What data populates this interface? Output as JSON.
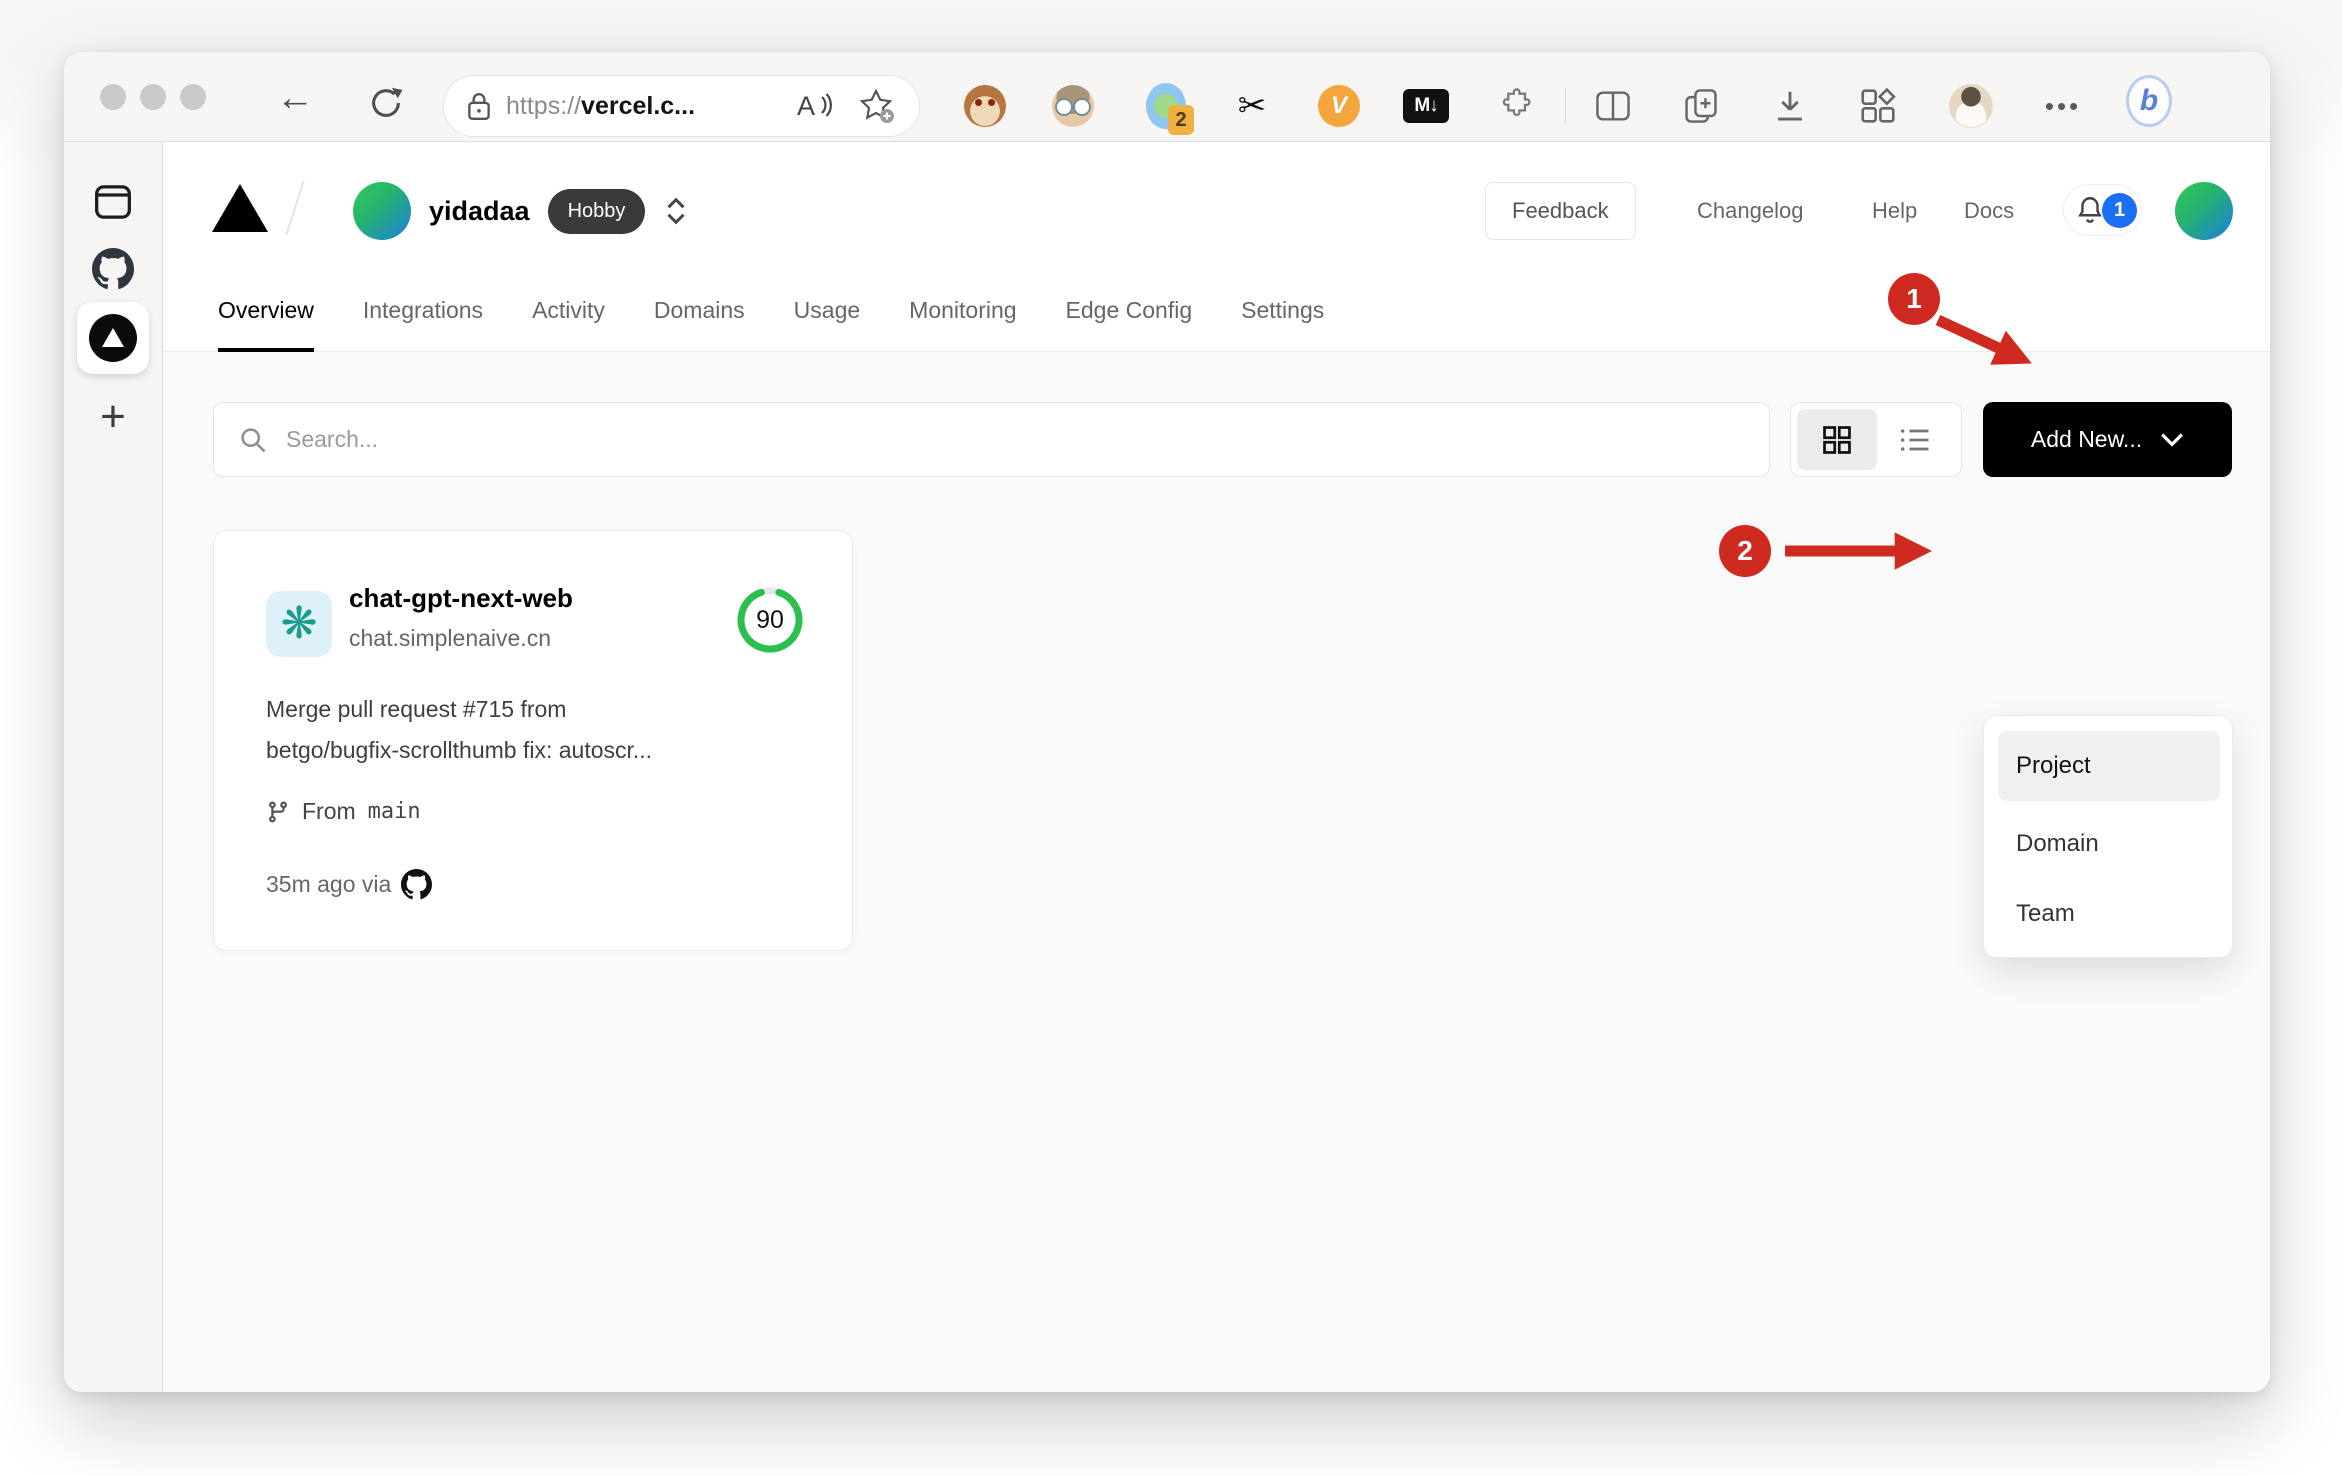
{
  "browser": {
    "url_scheme": "https://",
    "url_host": "vercel.c...",
    "extension_badge": "2",
    "v_extension_label": "V",
    "markdown_extension_label": "M↓",
    "menu_dots": "•••",
    "bing_label": "b"
  },
  "vercel": {
    "header": {
      "team_name": "yidadaa",
      "plan_badge": "Hobby",
      "feedback": "Feedback",
      "links": {
        "changelog": "Changelog",
        "help": "Help",
        "docs": "Docs"
      },
      "notification_count": "1"
    },
    "tabs": [
      {
        "label": "Overview",
        "active": true
      },
      {
        "label": "Integrations"
      },
      {
        "label": "Activity"
      },
      {
        "label": "Domains"
      },
      {
        "label": "Usage"
      },
      {
        "label": "Monitoring"
      },
      {
        "label": "Edge Config"
      },
      {
        "label": "Settings"
      }
    ],
    "toolbar_row": {
      "search_placeholder": "Search...",
      "add_new_label": "Add New..."
    },
    "dropdown": {
      "items": [
        {
          "label": "Project",
          "highlighted": true
        },
        {
          "label": "Domain"
        },
        {
          "label": "Team"
        }
      ]
    },
    "card": {
      "name": "chat-gpt-next-web",
      "domain": "chat.simplenaive.cn",
      "score": "90",
      "commit_line1": "Merge pull request #715 from",
      "commit_line2": "betgo/bugfix-scrollthumb fix: autoscr...",
      "branch_prefix": "From",
      "branch_name": "main",
      "deployed": "35m ago via"
    },
    "annotations": {
      "step1": "1",
      "step2": "2"
    }
  },
  "colors": {
    "annotation_red": "#cf2a1f",
    "add_new_bg": "#000000",
    "score_green": "#2bbf4e",
    "notification_blue": "#1a6ff3",
    "plan_badge_bg": "#3a3a3a",
    "openai_teal": "#1a9c8d",
    "openai_icon_bg": "#def0f8",
    "avatar_gradient": [
      "#2fcc59",
      "#1c7fe0"
    ]
  }
}
